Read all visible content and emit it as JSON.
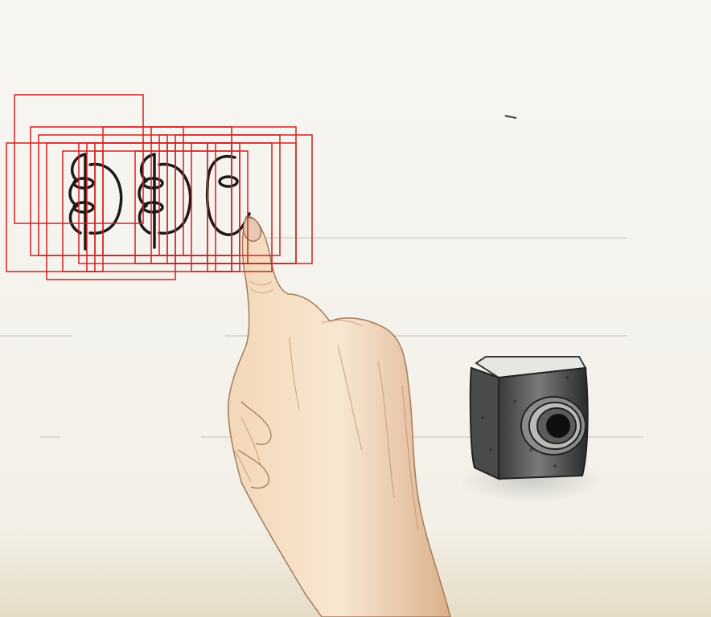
{
  "image": {
    "description_tags": [
      "illustration",
      "hand",
      "finger-writing",
      "ink-bottle",
      "red-boxes"
    ],
    "colors": {
      "paper": "#f5f3ee",
      "paper_bottom": "#e9e1cf",
      "ink": "#1a1a1a",
      "box": "#d42020",
      "skin_light": "#f6e2c9",
      "skin_mid": "#e7c4a0",
      "skin_shadow": "#c99b79",
      "bottle_dark": "#2e2e2e",
      "bottle_mid": "#6a6a6a",
      "bottle_light": "#d9d9d6"
    },
    "annotation_boxes_count": 18
  }
}
